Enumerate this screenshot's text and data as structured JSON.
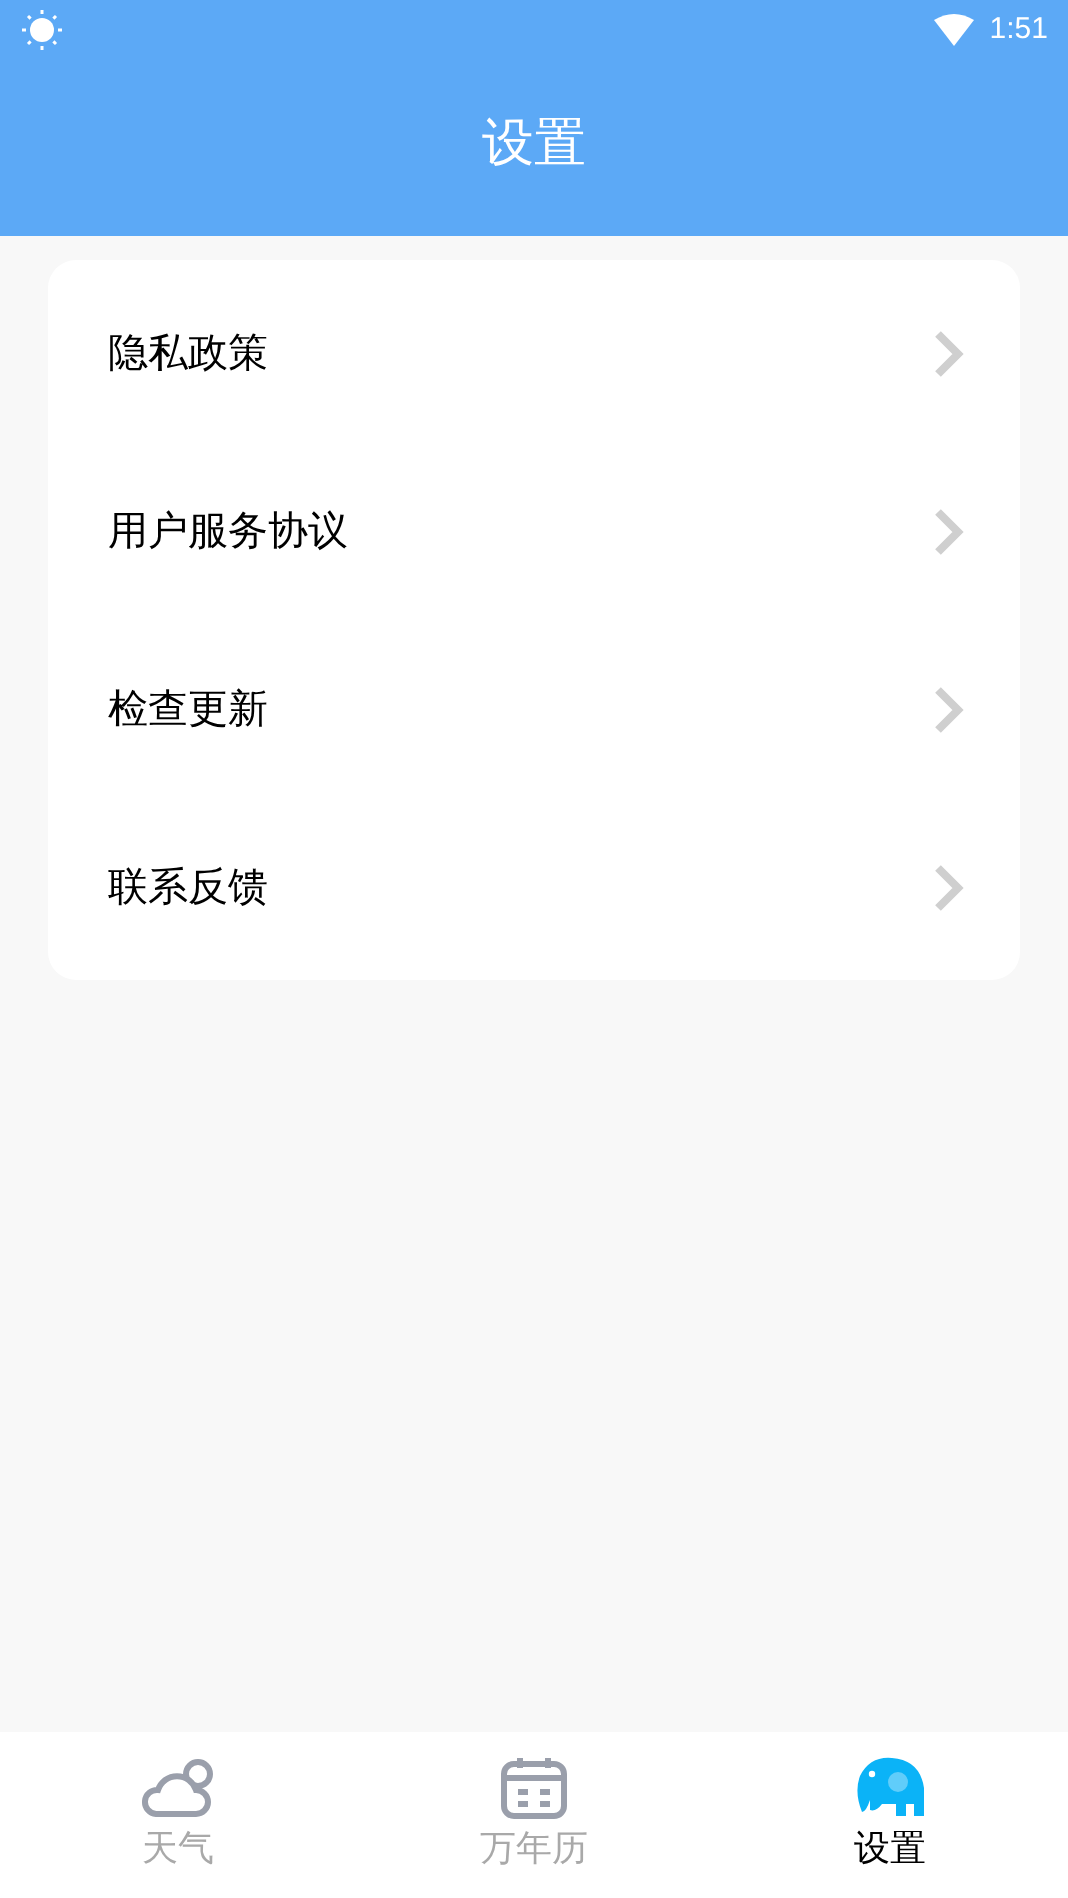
{
  "status_bar": {
    "time": "1:51"
  },
  "header": {
    "title": "设置"
  },
  "settings": [
    {
      "label": "隐私政策"
    },
    {
      "label": "用户服务协议"
    },
    {
      "label": "检查更新"
    },
    {
      "label": "联系反馈"
    }
  ],
  "tabs": [
    {
      "label": "天气",
      "kind": "weather",
      "selected": false
    },
    {
      "label": "万年历",
      "kind": "calendar",
      "selected": false
    },
    {
      "label": "设置",
      "kind": "settings",
      "selected": true
    }
  ]
}
